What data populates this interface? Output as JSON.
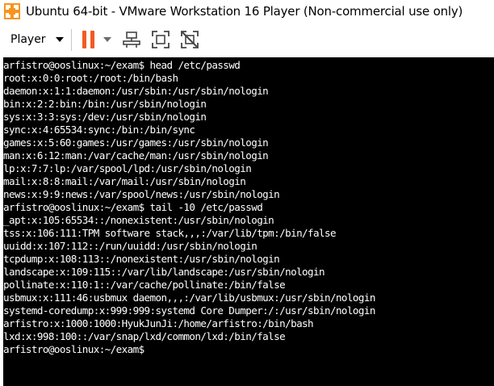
{
  "window": {
    "title": "Ubuntu 64-bit - VMware Workstation 16 Player (Non-commercial use only)",
    "app_icon": "vmware-player-icon"
  },
  "toolbar": {
    "player_menu_label": "Player",
    "buttons": [
      {
        "icon": "pause-icon",
        "color": "#f15a24"
      },
      {
        "icon": "pause-dropdown-icon"
      },
      {
        "icon": "send-ctrl-alt-del-icon"
      },
      {
        "icon": "full-screen-icon"
      },
      {
        "icon": "unity-mode-disabled-icon"
      }
    ]
  },
  "terminal": {
    "background": "#000000",
    "foreground": "#ffffff",
    "lines": [
      "arfistro@ooslinux:~/exam$ head /etc/passwd",
      "root:x:0:0:root:/root:/bin/bash",
      "daemon:x:1:1:daemon:/usr/sbin:/usr/sbin/nologin",
      "bin:x:2:2:bin:/bin:/usr/sbin/nologin",
      "sys:x:3:3:sys:/dev:/usr/sbin/nologin",
      "sync:x:4:65534:sync:/bin:/bin/sync",
      "games:x:5:60:games:/usr/games:/usr/sbin/nologin",
      "man:x:6:12:man:/var/cache/man:/usr/sbin/nologin",
      "lp:x:7:7:lp:/var/spool/lpd:/usr/sbin/nologin",
      "mail:x:8:8:mail:/var/mail:/usr/sbin/nologin",
      "news:x:9:9:news:/var/spool/news:/usr/sbin/nologin",
      "arfistro@ooslinux:~/exam$ tail -10 /etc/passwd",
      "_apt:x:105:65534::/nonexistent:/usr/sbin/nologin",
      "tss:x:106:111:TPM software stack,,,:/var/lib/tpm:/bin/false",
      "uuidd:x:107:112::/run/uuidd:/usr/sbin/nologin",
      "tcpdump:x:108:113::/nonexistent:/usr/sbin/nologin",
      "landscape:x:109:115::/var/lib/landscape:/usr/sbin/nologin",
      "pollinate:x:110:1::/var/cache/pollinate:/bin/false",
      "usbmux:x:111:46:usbmux daemon,,,:/var/lib/usbmux:/usr/sbin/nologin",
      "systemd-coredump:x:999:999:systemd Core Dumper:/:/usr/sbin/nologin",
      "arfistro:x:1000:1000:HyukJunJi:/home/arfistro:/bin/bash",
      "lxd:x:998:100::/var/snap/lxd/common/lxd:/bin/false",
      "arfistro@ooslinux:~/exam$ "
    ]
  }
}
